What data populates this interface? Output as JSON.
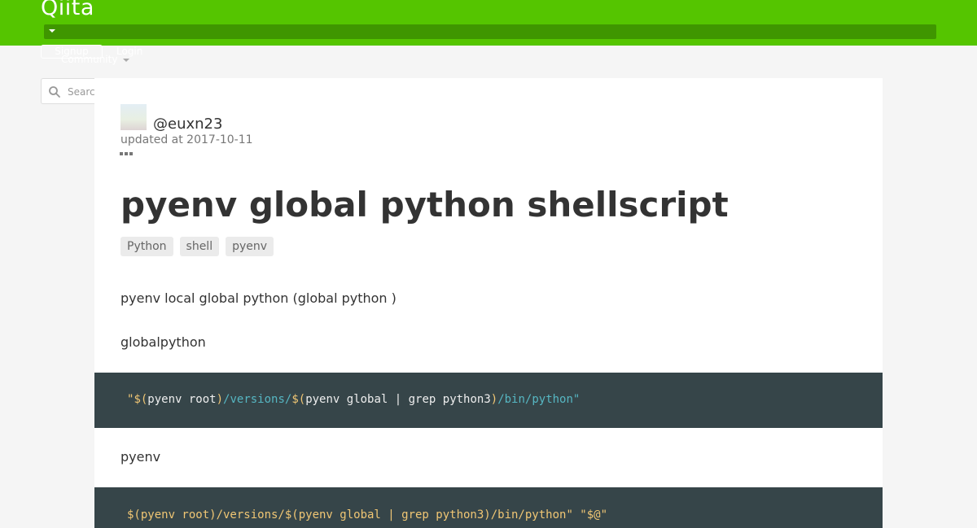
{
  "header": {
    "logo": "Qiita",
    "signup_label": "Signup",
    "login_label": "Login",
    "community_label": "Community"
  },
  "search": {
    "placeholder": "Search"
  },
  "article": {
    "username": "@euxn23",
    "updated": "updated at 2017-10-11",
    "title": "pyenv global python shellscript",
    "tags": [
      "Python",
      "shell",
      "pyenv"
    ],
    "paragraphs": [
      "pyenv local global python (global python )",
      "globalpython",
      "pyenv"
    ],
    "code1": {
      "quote_open": "\"",
      "sub_open": "$(",
      "cmd1": "pyenv root",
      "sub_close": ")",
      "path1": "/versions/",
      "sub_open2": "$(",
      "cmd2": "pyenv global | grep python3",
      "sub_close2": ")",
      "path2": "/bin/python\""
    },
    "code2": {
      "text": "$(pyenv root)/versions/$(pyenv global | grep python3)/bin/python\" \"$@\""
    }
  },
  "colors": {
    "brand": "#55c500",
    "brand_dark": "#3f9600",
    "code_bg": "#364549"
  }
}
